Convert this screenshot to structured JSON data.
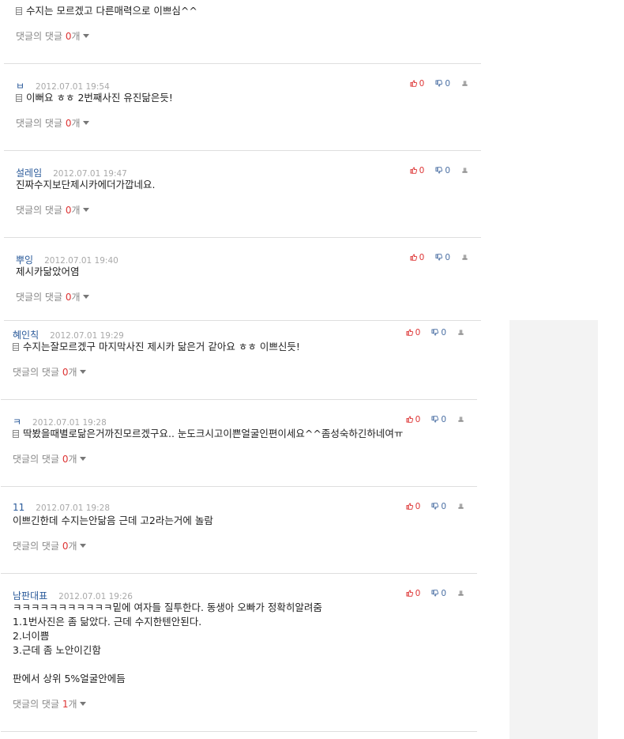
{
  "reply_label": "댓글의 댓글",
  "reply_unit": "개",
  "comments": [
    {
      "nick": "",
      "date": "",
      "likes": "",
      "dislikes": "",
      "mobile": true,
      "lines": [
        "수지는 모르겠고 다른매력으로 이쁘심^^"
      ],
      "reply_count": "0"
    },
    {
      "nick": "ㅂ",
      "date": "2012.07.01 19:54",
      "likes": "0",
      "dislikes": "0",
      "mobile": true,
      "lines": [
        "이뻐요 ㅎㅎ 2번째사진 유진닮은듯!"
      ],
      "reply_count": "0"
    },
    {
      "nick": "설레임",
      "date": "2012.07.01 19:47",
      "likes": "0",
      "dislikes": "0",
      "mobile": false,
      "lines": [
        "진짜수지보단제시카에더가깝네요."
      ],
      "reply_count": "0"
    },
    {
      "nick": "뿌잉",
      "date": "2012.07.01 19:40",
      "likes": "0",
      "dislikes": "0",
      "mobile": false,
      "lines": [
        "제시카닮았어염"
      ],
      "reply_count": "0"
    },
    {
      "nick": "혜인칙",
      "date": "2012.07.01 19:29",
      "likes": "0",
      "dislikes": "0",
      "mobile": true,
      "lines": [
        "수지는잘모르겠구 마지막사진 제시카 닮은거 같아요 ㅎㅎ 이쁘신듯!"
      ],
      "reply_count": "0"
    },
    {
      "nick": "ㅋ",
      "date": "2012.07.01 19:28",
      "likes": "0",
      "dislikes": "0",
      "mobile": true,
      "lines": [
        "딱봤을때별로닮은거까진모르겠구요.. 눈도크시고이쁜얼굴인편이세요^^좀성숙하긴하네여ㅠ"
      ],
      "reply_count": "0"
    },
    {
      "nick": "11",
      "date": "2012.07.01 19:28",
      "likes": "0",
      "dislikes": "0",
      "mobile": false,
      "lines": [
        "이쁘긴한데 수지는안닮음 근데 고2라는거에 놀람"
      ],
      "reply_count": "0"
    },
    {
      "nick": "남판대표",
      "date": "2012.07.01 19:26",
      "likes": "0",
      "dislikes": "0",
      "mobile": false,
      "lines": [
        "ㅋㅋㅋㅋㅋㅋㅋㅋㅋㅋㅋ밑에 여자들 질투한다. 동생아 오빠가 정확히알려줌",
        "1.1번사진은 좀 닮았다. 근데 수지한텐안된다.",
        "2.너이쁨",
        "3.근데 좀 노안이긴함",
        "",
        "판에서 상위 5%얼굴안에듬"
      ],
      "reply_count": "1"
    }
  ]
}
